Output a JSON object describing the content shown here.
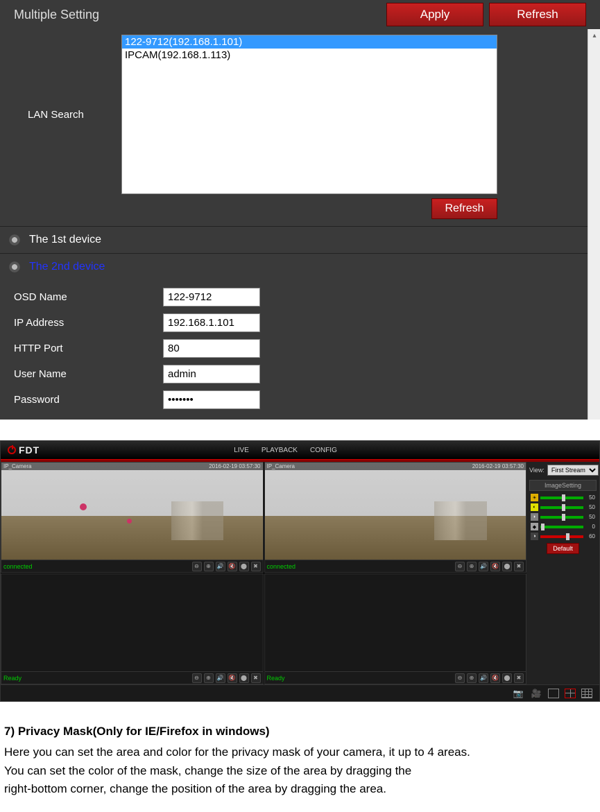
{
  "panel1": {
    "title": "Multiple Setting",
    "apply": "Apply",
    "refresh": "Refresh",
    "lan_search": "LAN Search",
    "lan_items": [
      "122-9712(192.168.1.101)",
      "IPCAM(192.168.1.113)"
    ],
    "lan_refresh": "Refresh",
    "device1": "The 1st device",
    "device2": "The 2nd device",
    "form": {
      "osd_label": "OSD Name",
      "osd_value": "122-9712",
      "ip_label": "IP Address",
      "ip_value": "192.168.1.101",
      "http_label": "HTTP Port",
      "http_value": "80",
      "user_label": "User Name",
      "user_value": "admin",
      "pass_label": "Password",
      "pass_value": "•••••••"
    }
  },
  "panel2": {
    "logo": "FDT",
    "tabs": {
      "live": "LIVE",
      "playback": "PLAYBACK",
      "config": "CONFIG"
    },
    "timestamps": {
      "cam_label": "IP_Camera",
      "ts": "2016-02-19 03:57:30"
    },
    "status": {
      "connected": "connected",
      "ready": "Ready"
    },
    "view_label": "View:",
    "view_value": "First Stream",
    "image_setting": "ImageSetting",
    "sliders": [
      {
        "name": "brightness",
        "value": "50",
        "pos": 50,
        "red": false,
        "color": "#e0b000"
      },
      {
        "name": "contrast",
        "value": "50",
        "pos": 50,
        "red": false,
        "color": "#e0e000"
      },
      {
        "name": "hue",
        "value": "50",
        "pos": 50,
        "red": false,
        "color": "#808080"
      },
      {
        "name": "saturation",
        "value": "0",
        "pos": 2,
        "red": false,
        "color": "#a0a0a0"
      },
      {
        "name": "sharpness",
        "value": "60",
        "pos": 60,
        "red": true,
        "color": "#404040"
      }
    ],
    "default_btn": "Default"
  },
  "doc": {
    "heading": "7) Privacy Mask(Only for IE/Firefox in windows)",
    "line1": "Here you can set the area and color for the privacy mask of your camera, it up to 4 areas.",
    "line2": "You can set the color of the mask, change the size of the area by dragging the",
    "line3": "right-bottom corner, change the position of the area by dragging the area."
  }
}
